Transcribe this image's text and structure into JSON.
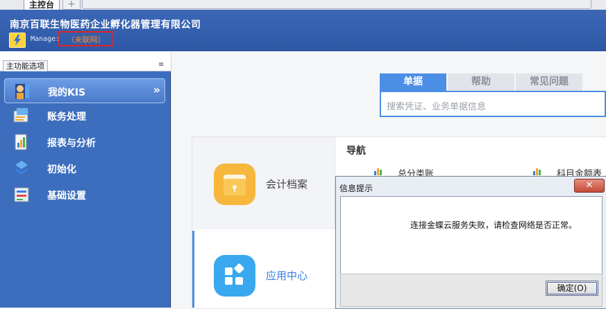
{
  "tabs": {
    "main_label": "主控台",
    "add_label": "+"
  },
  "header": {
    "company_name": "南京百联生物医药企业孵化器管理有限公司",
    "manage_label": "Manage:",
    "network_status": "（未联网）"
  },
  "left_panel": {
    "tab_label": "主功能选项",
    "menu_icon": "≡",
    "items": [
      {
        "label": "我的KIS",
        "icon": "user-icon",
        "active": true,
        "chevron": "»"
      },
      {
        "label": "账务处理",
        "icon": "ledger-icon",
        "active": false
      },
      {
        "label": "报表与分析",
        "icon": "report-icon",
        "active": false
      },
      {
        "label": "初始化",
        "icon": "init-icon",
        "active": false
      },
      {
        "label": "基础设置",
        "icon": "settings-icon",
        "active": false
      }
    ]
  },
  "search": {
    "tabs": [
      "单据",
      "帮助",
      "常见问题"
    ],
    "placeholder": "搜索凭证、业务单据信息"
  },
  "cards": [
    {
      "label": "会计档案",
      "icon": "archive-folder-icon"
    },
    {
      "label": "应用中心",
      "icon": "app-grid-icon"
    }
  ],
  "nav": {
    "title": "导航",
    "items": [
      "总分类账",
      "科目金额表"
    ]
  },
  "dialog": {
    "title": "信息提示",
    "close": "✕",
    "message": "连接金蝶云服务失败，请检查网络是否正常。",
    "ok_label": "确定(O)"
  },
  "colors": {
    "header_blue": "#3b67b6",
    "sidebar_blue": "#3c6ebd",
    "accent_blue": "#4b8ee6",
    "offline_red": "#e42222",
    "offline_text": "#ff8a2a"
  }
}
